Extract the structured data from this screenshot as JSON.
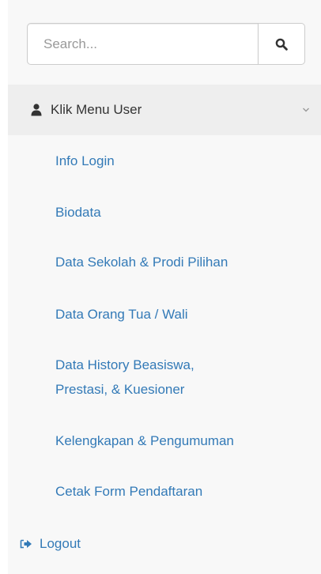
{
  "search": {
    "placeholder": "Search..."
  },
  "menu": {
    "header_label": "Klik Menu User",
    "items": [
      {
        "label": "Info Login"
      },
      {
        "label": "Biodata"
      },
      {
        "label": "Data Sekolah & Prodi Pilihan"
      },
      {
        "label": "Data Orang Tua / Wali"
      },
      {
        "label": "Data History Beasiswa,"
      },
      {
        "label": "Prestasi, & Kuesioner"
      },
      {
        "label": "Kelengkapan & Pengumuman"
      },
      {
        "label": "Cetak Form Pendaftaran"
      }
    ]
  },
  "logout": {
    "label": "Logout"
  },
  "icons": {
    "search": "search-icon",
    "user": "user-icon",
    "chevron": "chevron-down-icon",
    "logout": "sign-out-icon"
  },
  "colors": {
    "link": "#337ab7",
    "text": "#333333",
    "header_bg": "#eeeeee",
    "sidebar_bg": "#f8f8f8"
  }
}
